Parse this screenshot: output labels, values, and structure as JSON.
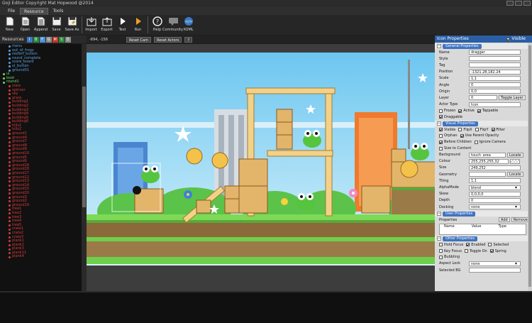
{
  "window": {
    "title": "Goji Editor Copyright Mat Hopwood @2014"
  },
  "menu": [
    "File",
    "Resource",
    "Tools"
  ],
  "menu_active": 1,
  "toolbar": [
    {
      "label": "New",
      "icon": "new-icon"
    },
    {
      "label": "Open",
      "icon": "open-icon"
    },
    {
      "label": "Append",
      "icon": "append-icon"
    },
    {
      "label": "Save",
      "icon": "save-icon"
    },
    {
      "label": "Save As",
      "icon": "save-as-icon"
    },
    {
      "label": "Import",
      "icon": "import-icon"
    },
    {
      "label": "Export",
      "icon": "export-icon"
    },
    {
      "label": "Test",
      "icon": "test-icon"
    },
    {
      "label": "Run",
      "icon": "run-icon"
    },
    {
      "label": "Help",
      "icon": "help-icon"
    },
    {
      "label": "Community",
      "icon": "community-icon"
    },
    {
      "label": "XOML",
      "icon": "xoml-icon"
    }
  ],
  "resources": {
    "label": "Resources",
    "filters": [
      {
        "text": "I",
        "color": "#3b78c2"
      },
      {
        "text": "B",
        "color": "#2c8a3c"
      },
      {
        "text": "F",
        "color": "#4a90d9"
      },
      {
        "text": "G",
        "color": "#8a8a8a"
      },
      {
        "text": "M",
        "color": "#c0392b"
      },
      {
        "text": "S",
        "color": "#2c8a3c"
      },
      {
        "text": "D",
        "color": "#8a8a8a"
      }
    ],
    "tree": [
      {
        "text": "menu",
        "color": "#5aa0e0"
      },
      {
        "text": "out_of_frogs",
        "color": "#5aa0e0"
      },
      {
        "text": "restart_button",
        "color": "#5aa0e0"
      },
      {
        "text": "round_complete",
        "color": "#5aa0e0"
      },
      {
        "text": "score_board",
        "color": "#5aa0e0"
      },
      {
        "text": "ui_button",
        "color": "#5aa0e0"
      },
      {
        "text": "ground01",
        "color": "#5aa0e0"
      },
      {
        "text": "ui",
        "color": "#6fd66f"
      },
      {
        "text": "boot",
        "color": "#6fd66f"
      },
      {
        "text": "round1",
        "color": "#6fd66f"
      },
      {
        "text": "stars",
        "color": "#d43a3a"
      },
      {
        "text": "spinner",
        "color": "#d43a3a"
      },
      {
        "text": "sky",
        "color": "#d43a3a"
      },
      {
        "text": "grass",
        "color": "#d43a3a"
      },
      {
        "text": "building1",
        "color": "#d43a3a"
      },
      {
        "text": "building2",
        "color": "#d43a3a"
      },
      {
        "text": "building3",
        "color": "#d43a3a"
      },
      {
        "text": "building4",
        "color": "#d43a3a"
      },
      {
        "text": "building5",
        "color": "#d43a3a"
      },
      {
        "text": "building6",
        "color": "#d43a3a"
      },
      {
        "text": "hills1",
        "color": "#d43a3a"
      },
      {
        "text": "hills2",
        "color": "#d43a3a"
      },
      {
        "text": "ground1",
        "color": "#d43a3a"
      },
      {
        "text": "ground4",
        "color": "#d43a3a"
      },
      {
        "text": "ground7",
        "color": "#d43a3a"
      },
      {
        "text": "ground8",
        "color": "#d43a3a"
      },
      {
        "text": "ground9",
        "color": "#d43a3a"
      },
      {
        "text": "ground10",
        "color": "#d43a3a"
      },
      {
        "text": "ground5",
        "color": "#d43a3a"
      },
      {
        "text": "ground6",
        "color": "#d43a3a"
      },
      {
        "text": "ground16",
        "color": "#d43a3a"
      },
      {
        "text": "ground18",
        "color": "#d43a3a"
      },
      {
        "text": "ground17",
        "color": "#d43a3a"
      },
      {
        "text": "ground12",
        "color": "#d43a3a"
      },
      {
        "text": "ground13",
        "color": "#d43a3a"
      },
      {
        "text": "ground14",
        "color": "#d43a3a"
      },
      {
        "text": "ground15",
        "color": "#d43a3a"
      },
      {
        "text": "ground20",
        "color": "#d43a3a"
      },
      {
        "text": "ground3",
        "color": "#d43a3a"
      },
      {
        "text": "ground2",
        "color": "#d43a3a"
      },
      {
        "text": "ground19",
        "color": "#d43a3a"
      },
      {
        "text": "tree1",
        "color": "#d43a3a"
      },
      {
        "text": "tree2",
        "color": "#d43a3a"
      },
      {
        "text": "tree3",
        "color": "#d43a3a"
      },
      {
        "text": "tree4",
        "color": "#d43a3a"
      },
      {
        "text": "tree5",
        "color": "#d43a3a"
      },
      {
        "text": "crate1",
        "color": "#d43a3a"
      },
      {
        "text": "crate2",
        "color": "#d43a3a"
      },
      {
        "text": "crate3",
        "color": "#d43a3a"
      },
      {
        "text": "plank1",
        "color": "#d43a3a"
      },
      {
        "text": "plank2",
        "color": "#d43a3a"
      },
      {
        "text": "plank3",
        "color": "#d43a3a"
      },
      {
        "text": "plank11",
        "color": "#d43a3a"
      },
      {
        "text": "plank4",
        "color": "#d43a3a"
      }
    ]
  },
  "canvas_bar": {
    "coords": "-894, -156",
    "reset_cam": "Reset Cam",
    "reset_actors": "Reset Actors",
    "help": "?"
  },
  "props": {
    "title": "Icon Properties",
    "visible_label": "Visible",
    "general": {
      "title": "General Properties",
      "rows": [
        {
          "label": "Name",
          "value": "dragger"
        },
        {
          "label": "Style",
          "value": ""
        },
        {
          "label": "Tag",
          "value": ""
        },
        {
          "label": "Position",
          "value": "-1321.28,182.24"
        },
        {
          "label": "Scale",
          "value": "1,1"
        },
        {
          "label": "Angle",
          "value": "0"
        },
        {
          "label": "Origin",
          "value": "0,0"
        },
        {
          "label": "Layer",
          "value": "0"
        },
        {
          "label": "Actor Type",
          "value": "Icon"
        }
      ],
      "toggle_layer": "Toggle Layer",
      "checks1": [
        {
          "label": "Frozen",
          "on": false
        },
        {
          "label": "Active",
          "on": true
        },
        {
          "label": "Tappable",
          "on": true
        }
      ],
      "checks2": [
        {
          "label": "Draggable",
          "on": true
        }
      ]
    },
    "visual": {
      "title": "Visual Properties",
      "checks": [
        [
          {
            "label": "Visible",
            "on": true
          },
          {
            "label": "FlipX",
            "on": false
          },
          {
            "label": "FlipY",
            "on": false
          },
          {
            "label": "Filter",
            "on": true
          }
        ],
        [
          {
            "label": "Orphan",
            "on": false
          },
          {
            "label": "Use Parent Opacity",
            "on": true
          }
        ],
        [
          {
            "label": "Before Children",
            "on": true
          },
          {
            "label": "Ignore Camera",
            "on": false
          }
        ],
        [
          {
            "label": "Size to Content",
            "on": false
          }
        ]
      ],
      "rows": [
        {
          "label": "Background",
          "value": "touch_area",
          "button": "Locate"
        },
        {
          "label": "Colour",
          "value": "255,255,255,32",
          "swatch": true
        },
        {
          "label": "Size",
          "value": "249,252"
        },
        {
          "label": "Geometry",
          "value": "",
          "button": "Locate"
        },
        {
          "label": "Tiling",
          "value": "1,1"
        },
        {
          "label": "AlphaMode",
          "value": "blend",
          "select": true
        },
        {
          "label": "Skew",
          "value": "0,0,0,0"
        },
        {
          "label": "Depth",
          "value": "0"
        },
        {
          "label": "Docking",
          "value": "none",
          "select": true
        }
      ]
    },
    "user": {
      "title": "User Properties",
      "label": "Properties",
      "add": "Add",
      "remove": "Remove",
      "columns": [
        "Name",
        "Value",
        "Type"
      ]
    },
    "other": {
      "title": "Other Properties",
      "checks": [
        [
          {
            "label": "Hold Focus",
            "on": false
          },
          {
            "label": "Enabled",
            "on": true
          },
          {
            "label": "Selected",
            "on": false
          }
        ],
        [
          {
            "label": "Key Focus",
            "on": false
          },
          {
            "label": "Toggle On",
            "on": false
          },
          {
            "label": "Spring",
            "on": true
          }
        ],
        [
          {
            "label": "Bubbling",
            "on": false
          }
        ]
      ],
      "rows": [
        {
          "label": "Aspect Lock",
          "value": "none",
          "select": true
        },
        {
          "label": "Selected BG",
          "value": ""
        }
      ]
    }
  }
}
